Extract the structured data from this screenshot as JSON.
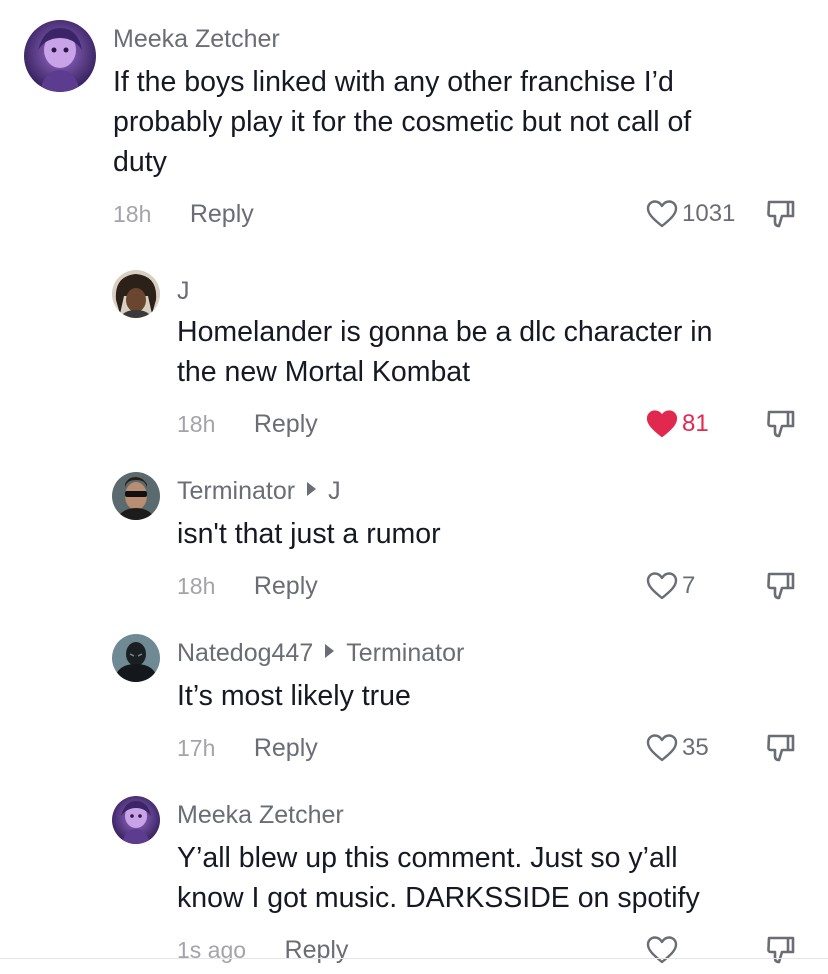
{
  "comments": [
    {
      "username": "Meeka Zetcher",
      "reply_to": "",
      "text_lines": [
        "If the boys linked with any other franchise I’d",
        "probably play it for the cosmetic but not call of",
        "duty"
      ],
      "time": "18h",
      "reply_label": "Reply",
      "likes": "1031",
      "liked": false,
      "avatar_icon": "purple-anime-avatar"
    },
    {
      "username": "J",
      "reply_to": "",
      "text_lines": [
        "Homelander is gonna be a dlc character in",
        "the new Mortal Kombat"
      ],
      "time": "18h",
      "reply_label": "Reply",
      "likes": "81",
      "liked": true,
      "avatar_icon": "dreadlocks-person-avatar"
    },
    {
      "username": "Terminator",
      "reply_to": "J",
      "text_lines": [
        "isn't that just a rumor"
      ],
      "time": "18h",
      "reply_label": "Reply",
      "likes": "7",
      "liked": false,
      "avatar_icon": "terminator-sunglasses-avatar"
    },
    {
      "username": "Natedog447",
      "reply_to": "Terminator",
      "text_lines": [
        "It’s most likely true"
      ],
      "time": "17h",
      "reply_label": "Reply",
      "likes": "35",
      "liked": false,
      "avatar_icon": "dark-superhero-avatar"
    },
    {
      "username": "Meeka Zetcher",
      "reply_to": "",
      "text_lines": [
        "Y’all blew up this comment. Just so y’all",
        "know I got music. DARKSSIDE on spotify"
      ],
      "time": "1s ago",
      "reply_label": "Reply",
      "likes": "",
      "liked": false,
      "avatar_icon": "purple-anime-avatar"
    }
  ],
  "colors": {
    "liked_heart": "#e1294f",
    "secondary_text": "#6b6d75",
    "timestamp": "#a3a4a9",
    "primary_text": "#161823"
  }
}
